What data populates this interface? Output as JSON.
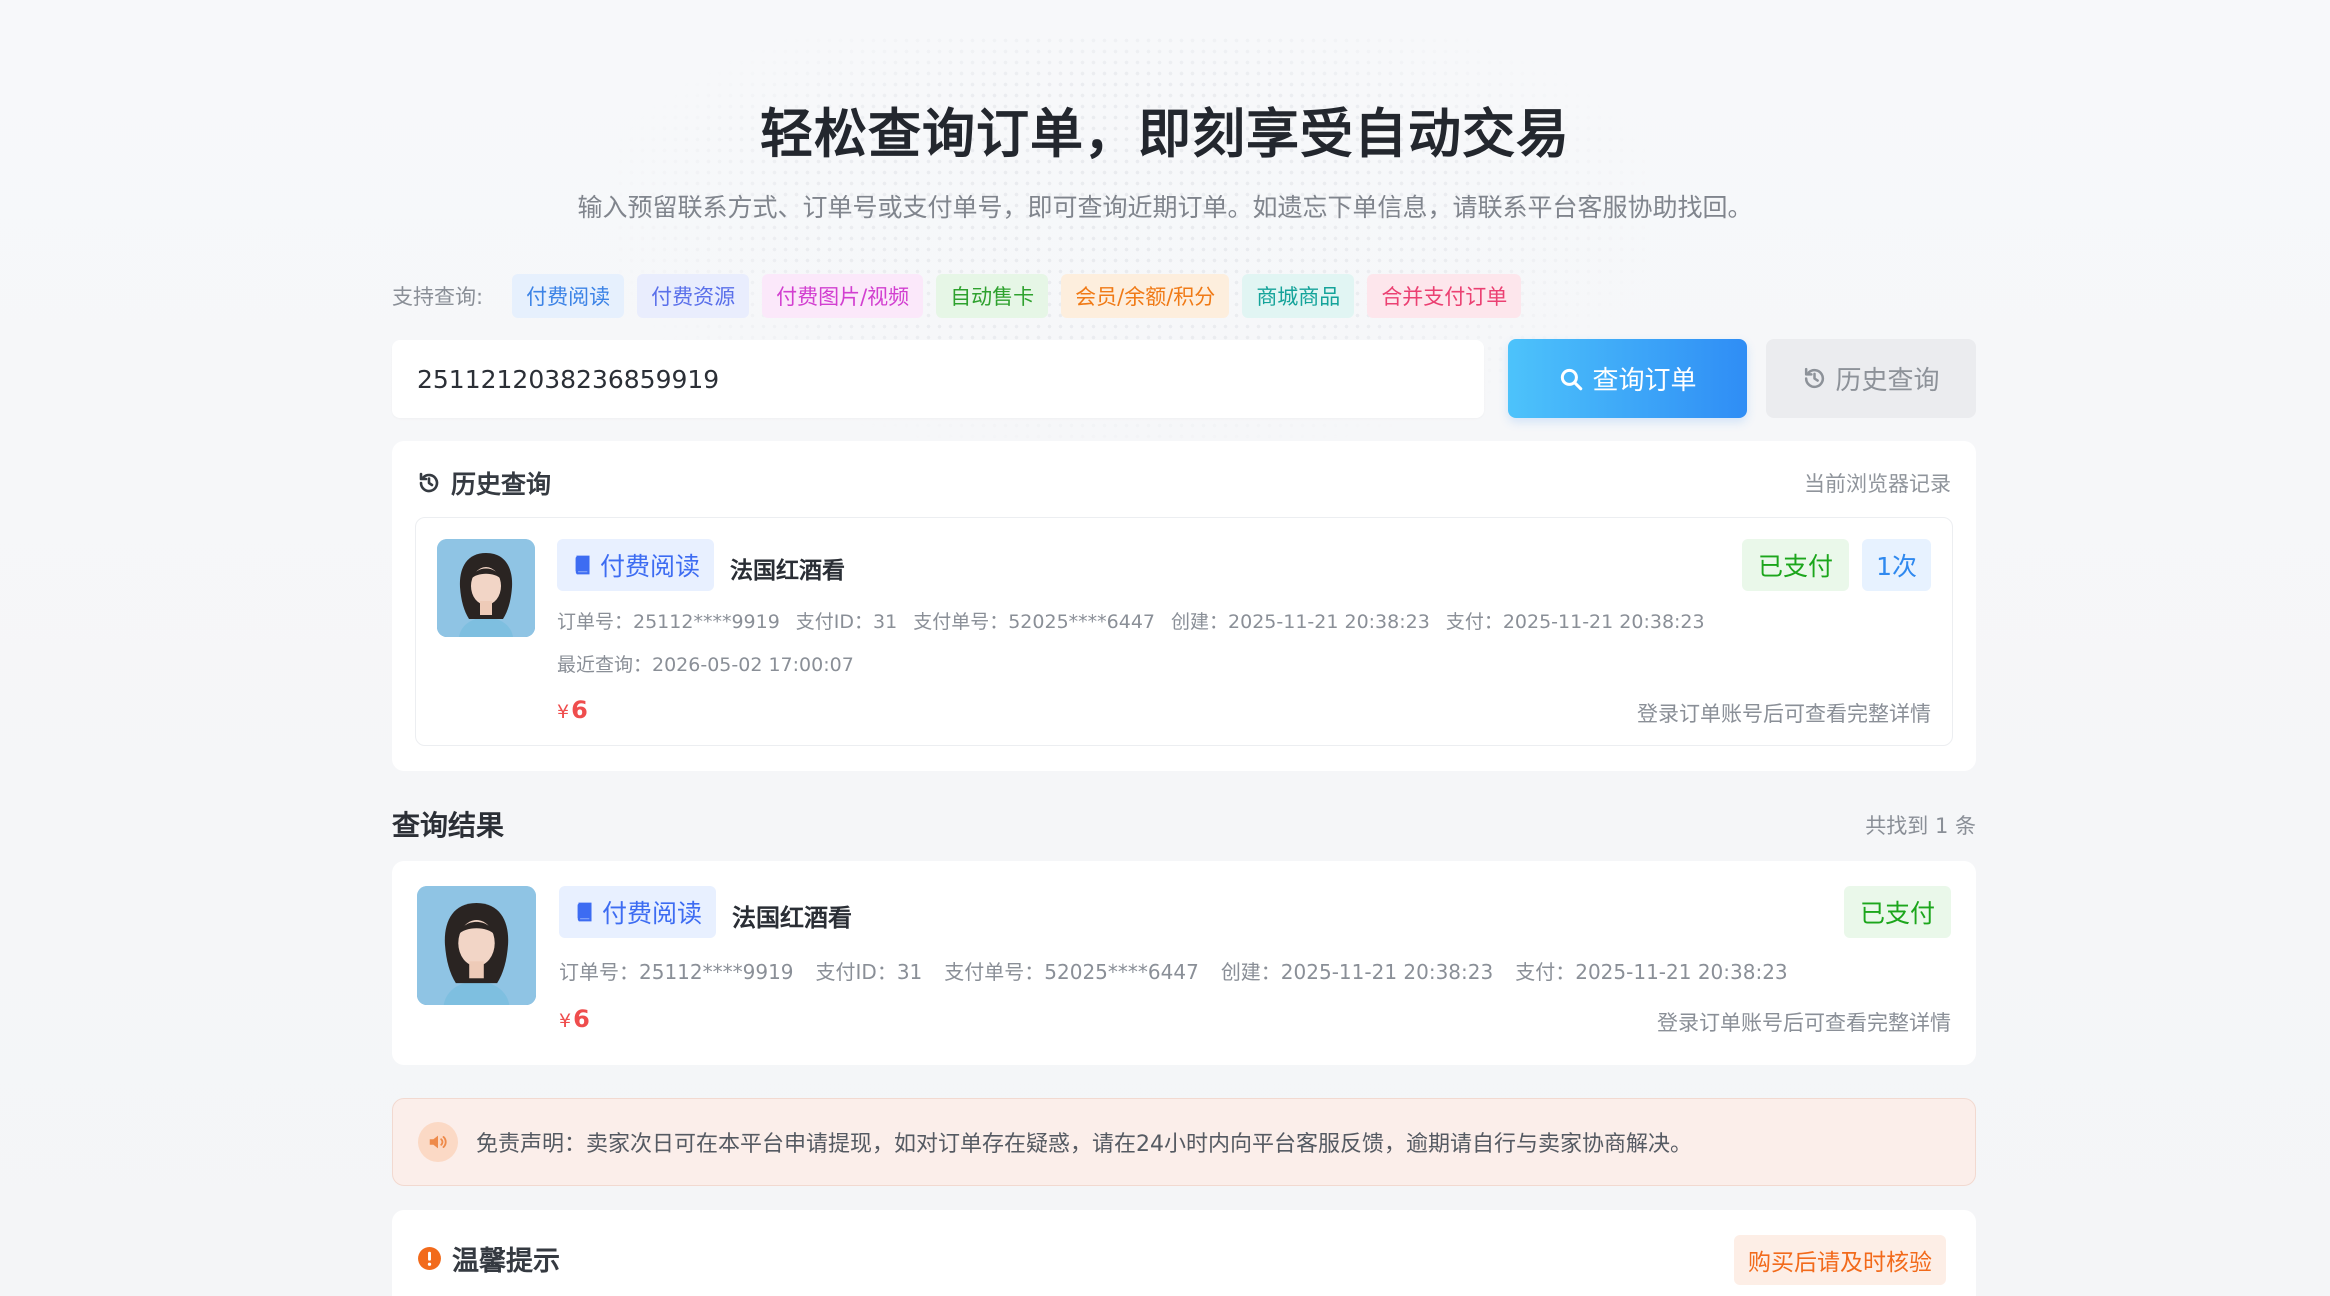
{
  "hero": {
    "title": "轻松查询订单，即刻享受自动交易",
    "subtitle": "输入预留联系方式、订单号或支付单号，即可查询近期订单。如遗忘下单信息，请联系平台客服协助找回。"
  },
  "support": {
    "label": "支持查询:",
    "tags": [
      {
        "label": "付费阅读",
        "color": "#3c83e6",
        "bg": "#e6f0fd"
      },
      {
        "label": "付费资源",
        "color": "#5a70ea",
        "bg": "#e9edfd"
      },
      {
        "label": "付费图片/视频",
        "color": "#d23fd0",
        "bg": "#fbe8fa"
      },
      {
        "label": "自动售卡",
        "color": "#2ea12e",
        "bg": "#e6f6e6"
      },
      {
        "label": "会员/余额/积分",
        "color": "#f07a16",
        "bg": "#fdeedd"
      },
      {
        "label": "商城商品",
        "color": "#14a39a",
        "bg": "#e1f5f3"
      },
      {
        "label": "合并支付订单",
        "color": "#eb4072",
        "bg": "#fde6ec"
      }
    ]
  },
  "search": {
    "value": "2511212038236859919",
    "query_button": "查询订单",
    "history_button": "历史查询"
  },
  "history": {
    "title": "历史查询",
    "note": "当前浏览器记录",
    "order": {
      "type_label": "付费阅读",
      "product": "法国红酒看",
      "status": "已支付",
      "count": "1次",
      "meta": [
        "订单号：25112****9919",
        "支付ID：31",
        "支付单号：52025****6447",
        "创建：2025-11-21 20:38:23",
        "支付：2025-11-21 20:38:23"
      ],
      "last_query": "最近查询：2026-05-02 17:00:07",
      "currency": "¥",
      "price": "6",
      "detail_hint": "登录订单账号后可查看完整详情"
    }
  },
  "results": {
    "title": "查询结果",
    "count_text": "共找到 1 条",
    "order": {
      "type_label": "付费阅读",
      "product": "法国红酒看",
      "status": "已支付",
      "meta": [
        "订单号：25112****9919",
        "支付ID：31",
        "支付单号：52025****6447",
        "创建：2025-11-21 20:38:23",
        "支付：2025-11-21 20:38:23"
      ],
      "currency": "¥",
      "price": "6",
      "detail_hint": "登录订单账号后可查看完整详情"
    }
  },
  "disclaimer": {
    "text": "免责声明：卖家次日可在本平台申请提现，如对订单存在疑惑，请在24小时内向平台客服反馈，逾期请自行与卖家协商解决。"
  },
  "tips": {
    "title": "温馨提示",
    "badge": "购买后请及时核验"
  },
  "icons": {
    "search": "search-icon",
    "history": "history-icon",
    "book": "book-icon",
    "speaker": "speaker-icon",
    "alert": "alert-circle-icon"
  }
}
